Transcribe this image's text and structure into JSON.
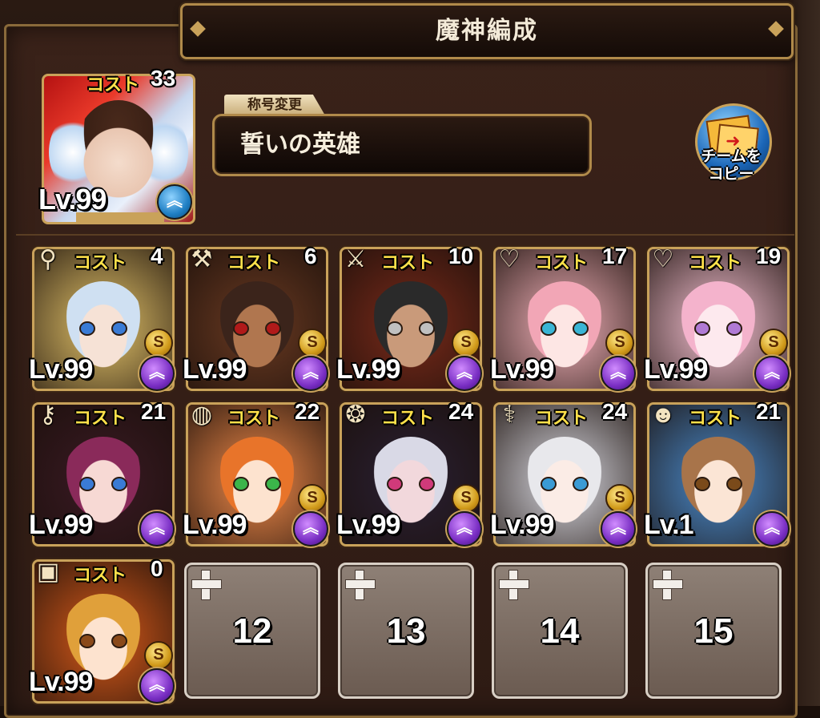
{
  "screen": {
    "title": "魔神編成",
    "leader": {
      "cost_label": "コスト",
      "cost": "33",
      "level": "Lv.99",
      "upgrade_icon": "chevron-up-icon",
      "palette": "red-white"
    },
    "team_title": {
      "tag": "称号変更",
      "value": "誓いの英雄"
    },
    "copy_button": {
      "line1": "チームを",
      "line2": "コピー",
      "icon": "card-copy-icon"
    }
  },
  "units": [
    {
      "weapon": "spear-icon",
      "cost": "4",
      "level": "Lv.99",
      "rank": "S",
      "hair": "#cfe0f2",
      "skin": "#f6e2d6",
      "eye": "#3a7bd5",
      "bg": "#e3c36a"
    },
    {
      "weapon": "axe-icon",
      "cost": "6",
      "level": "Lv.99",
      "rank": "S",
      "hair": "#3b241b",
      "skin": "#b0764f",
      "eye": "#b01a1a",
      "bg": "#6a3a22"
    },
    {
      "weapon": "sword-icon",
      "cost": "10",
      "level": "Lv.99",
      "rank": "S",
      "hair": "#2a2a2a",
      "skin": "#c99a7a",
      "eye": "#c0c0c0",
      "bg": "#7a2a1a"
    },
    {
      "weapon": "heart-icon",
      "cost": "17",
      "level": "Lv.99",
      "rank": "S",
      "hair": "#f2a6b6",
      "skin": "#fde6e4",
      "eye": "#3ab5d5",
      "bg": "#f0b0b8"
    },
    {
      "weapon": "heart-icon",
      "cost": "19",
      "level": "Lv.99",
      "rank": "S",
      "hair": "#f4b3cc",
      "skin": "#fde9ee",
      "eye": "#b07ad5",
      "bg": "#f5c1d2"
    },
    {
      "weapon": "key-icon",
      "cost": "21",
      "level": "Lv.99",
      "rank": "",
      "hair": "#8a2a5a",
      "skin": "#f7d9d4",
      "eye": "#3a7bd5",
      "bg": "#3a1a24"
    },
    {
      "weapon": "pan-icon",
      "cost": "22",
      "level": "Lv.99",
      "rank": "S",
      "hair": "#e8742a",
      "skin": "#fde3cf",
      "eye": "#3bb54a",
      "bg": "#f08a4a"
    },
    {
      "weapon": "lion-icon",
      "cost": "24",
      "level": "Lv.99",
      "rank": "S",
      "hair": "#d9d9e6",
      "skin": "#f2d8dc",
      "eye": "#d03a7a",
      "bg": "#2a2033"
    },
    {
      "weapon": "wand-icon",
      "cost": "24",
      "level": "Lv.99",
      "rank": "S",
      "hair": "#e8e8ec",
      "skin": "#fbece6",
      "eye": "#3a9bd5",
      "bg": "#d8d8e0"
    },
    {
      "weapon": "ghost-icon",
      "cost": "21",
      "level": "Lv.1",
      "rank": "",
      "hair": "#a8744a",
      "skin": "#fbe5d5",
      "eye": "#7a4a1a",
      "bg": "#4a8acb"
    },
    {
      "weapon": "chest-icon",
      "cost": "0",
      "level": "Lv.99",
      "rank": "S",
      "hair": "#e0a03a",
      "skin": "#fde3cf",
      "eye": "#8a4a1a",
      "bg": "#d85a1a"
    }
  ],
  "empty_slots": [
    "12",
    "13",
    "14",
    "15"
  ],
  "labels": {
    "cost": "コスト"
  }
}
